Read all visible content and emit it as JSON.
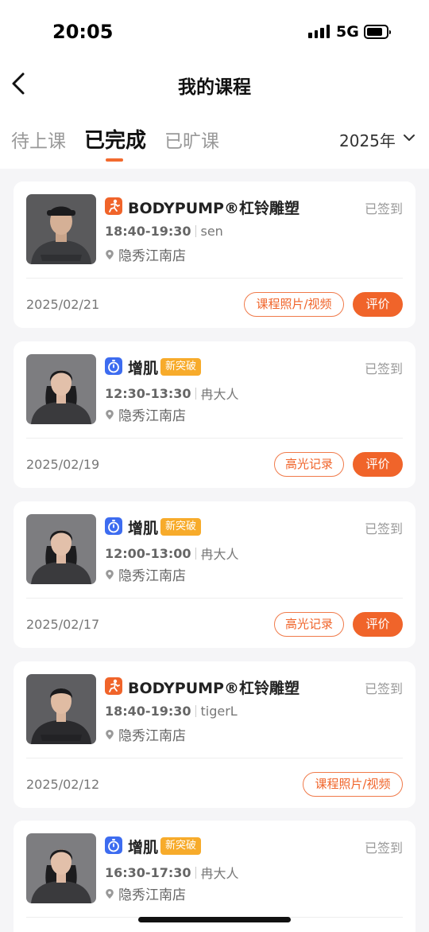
{
  "status": {
    "time": "20:05",
    "network": "5G"
  },
  "nav": {
    "title": "我的课程"
  },
  "tabs": {
    "items": [
      "待上课",
      "已完成",
      "已旷课"
    ],
    "active": "已完成",
    "year": "2025年"
  },
  "colors": {
    "accent": "#f0642a",
    "badge": "#f7ab2b",
    "bodypump_icon": "#f0642a",
    "muscle_icon": "#3d6cf0"
  },
  "courses": [
    {
      "name": "BODYPUMP®杠铃雕塑",
      "icon": "running-person-icon",
      "badge": "",
      "status": "已签到",
      "time": "18:40-19:30",
      "coach": "sen",
      "location": "隐秀江南店",
      "date": "2025/02/21",
      "buttons": [
        "课程照片/视频",
        "评价"
      ]
    },
    {
      "name": "增肌",
      "icon": "stopwatch-icon",
      "badge": "新突破",
      "status": "已签到",
      "time": "12:30-13:30",
      "coach": "冉大人",
      "location": "隐秀江南店",
      "date": "2025/02/19",
      "buttons": [
        "高光记录",
        "评价"
      ]
    },
    {
      "name": "增肌",
      "icon": "stopwatch-icon",
      "badge": "新突破",
      "status": "已签到",
      "time": "12:00-13:00",
      "coach": "冉大人",
      "location": "隐秀江南店",
      "date": "2025/02/17",
      "buttons": [
        "高光记录",
        "评价"
      ]
    },
    {
      "name": "BODYPUMP®杠铃雕塑",
      "icon": "running-person-icon",
      "badge": "",
      "status": "已签到",
      "time": "18:40-19:30",
      "coach": "tigerL",
      "location": "隐秀江南店",
      "date": "2025/02/12",
      "buttons": [
        "课程照片/视频"
      ]
    },
    {
      "name": "增肌",
      "icon": "stopwatch-icon",
      "badge": "新突破",
      "status": "已签到",
      "time": "16:30-17:30",
      "coach": "冉大人",
      "location": "隐秀江南店",
      "date": "",
      "buttons": []
    }
  ]
}
